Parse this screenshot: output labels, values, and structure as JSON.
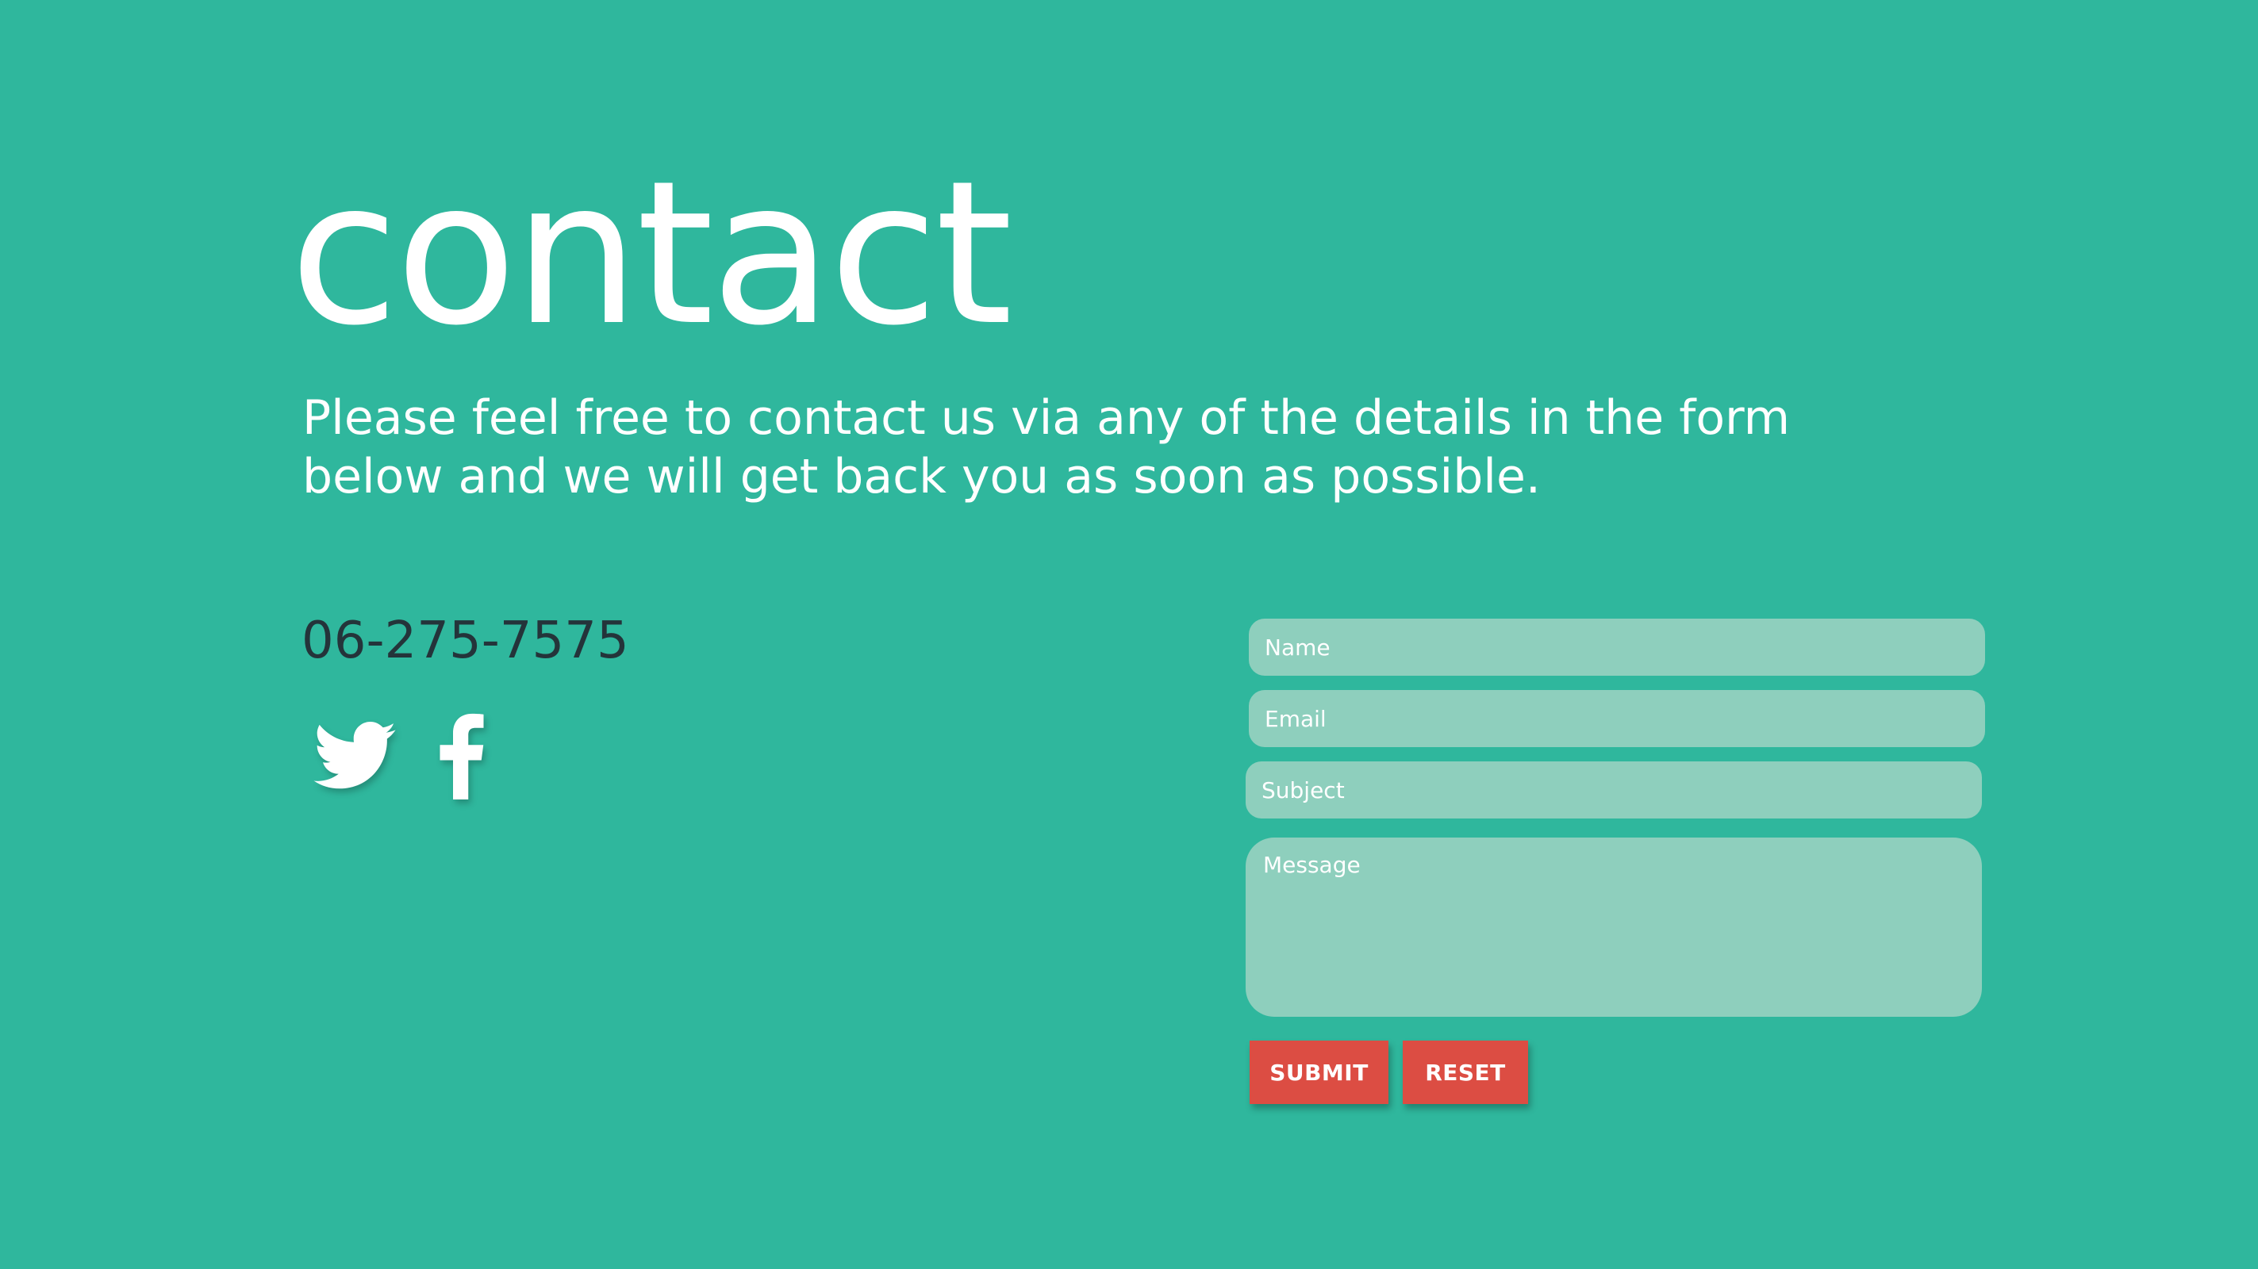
{
  "page": {
    "title": "contact",
    "intro": "Please feel free to contact us via any of the details in the form below and we will get back you as soon as possible.",
    "phone": "06-275-7575"
  },
  "social": {
    "icons": [
      "twitter-icon",
      "facebook-icon"
    ]
  },
  "form": {
    "name_placeholder": "Name",
    "email_placeholder": "Email",
    "subject_placeholder": "Subject",
    "message_placeholder": "Message",
    "submit_label": "SUBMIT",
    "reset_label": "RESET"
  },
  "colors": {
    "background": "#2fb79d",
    "field": "#8ecfbd",
    "button": "#dc4d43",
    "phone_text": "#24343a",
    "text": "#ffffff"
  }
}
